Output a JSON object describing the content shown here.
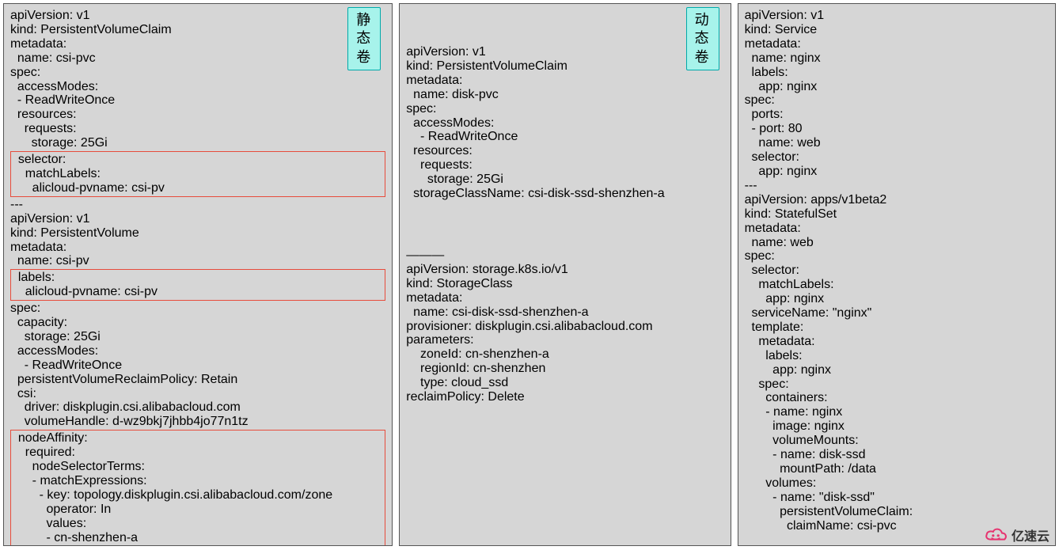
{
  "panel1": {
    "badge": "静态卷",
    "highlightA": [
      "  selector:",
      "    matchLabels:",
      "      alicloud-pvname: csi-pv"
    ],
    "highlightB": [
      "  labels:",
      "    alicloud-pvname: csi-pv"
    ],
    "highlightC": [
      "  nodeAffinity:",
      "    required:",
      "      nodeSelectorTerms:",
      "      - matchExpressions:",
      "        - key: topology.diskplugin.csi.alibabacloud.com/zone",
      "          operator: In",
      "          values:",
      "          - cn-shenzhen-a"
    ],
    "linesTop": [
      "apiVersion: v1",
      "kind: PersistentVolumeClaim",
      "metadata:",
      "  name: csi-pvc",
      "spec:",
      "  accessModes:",
      "  - ReadWriteOnce",
      "  resources:",
      "    requests:",
      "      storage: 25Gi"
    ],
    "linesMid1": [
      "---",
      "apiVersion: v1",
      "kind: PersistentVolume",
      "metadata:",
      "  name: csi-pv"
    ],
    "linesMid2": [
      "spec:",
      "  capacity:",
      "    storage: 25Gi",
      "  accessModes:",
      "    - ReadWriteOnce",
      "  persistentVolumeReclaimPolicy: Retain",
      "  csi:",
      "    driver: diskplugin.csi.alibabacloud.com",
      "    volumeHandle: d-wz9bkj7jhbb4jo77n1tz"
    ]
  },
  "panel2": {
    "badge": "动态卷",
    "linesTop": [
      "apiVersion: v1",
      "kind: PersistentVolumeClaim",
      "metadata:",
      "  name: disk-pvc",
      "spec:",
      "  accessModes:",
      "    - ReadWriteOnce",
      "  resources:",
      "    requests:",
      "      storage: 25Gi",
      "  storageClassName: csi-disk-ssd-shenzhen-a"
    ],
    "sep": "———",
    "linesBottom": [
      "apiVersion: storage.k8s.io/v1",
      "kind: StorageClass",
      "metadata:",
      "  name: csi-disk-ssd-shenzhen-a",
      "provisioner: diskplugin.csi.alibabacloud.com",
      "parameters:",
      "    zoneId: cn-shenzhen-a",
      "    regionId: cn-shenzhen",
      "    type: cloud_ssd",
      "reclaimPolicy: Delete"
    ]
  },
  "panel3": {
    "lines": [
      "apiVersion: v1",
      "kind: Service",
      "metadata:",
      "  name: nginx",
      "  labels:",
      "    app: nginx",
      "spec:",
      "  ports:",
      "  - port: 80",
      "    name: web",
      "  selector:",
      "    app: nginx",
      "---",
      "apiVersion: apps/v1beta2",
      "kind: StatefulSet",
      "metadata:",
      "  name: web",
      "spec:",
      "  selector:",
      "    matchLabels:",
      "      app: nginx",
      "  serviceName: \"nginx\"",
      "  template:",
      "    metadata:",
      "      labels:",
      "        app: nginx",
      "    spec:",
      "      containers:",
      "      - name: nginx",
      "        image: nginx",
      "        volumeMounts:",
      "        - name: disk-ssd",
      "          mountPath: /data",
      "      volumes:",
      "        - name: \"disk-ssd\"",
      "          persistentVolumeClaim:",
      "            claimName: csi-pvc"
    ]
  },
  "logoText": "亿速云"
}
